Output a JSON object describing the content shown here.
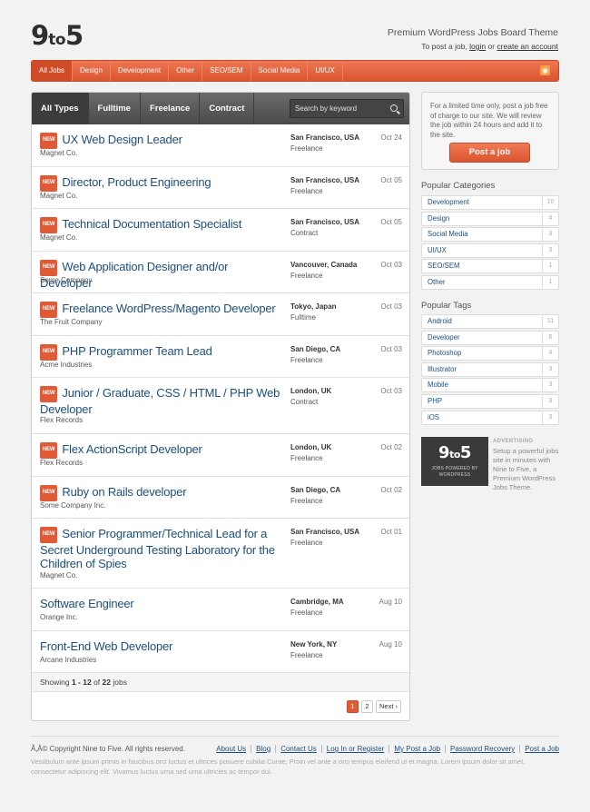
{
  "header": {
    "logo_big": "9",
    "logo_small": "to",
    "logo_big2": "5",
    "tagline": "Premium WordPress Jobs Board Theme",
    "post_prefix": "To post a job, ",
    "login": "login",
    "or": " or ",
    "create_account": "create an account"
  },
  "nav": {
    "items": [
      "All Jobs",
      "Design",
      "Development",
      "Other",
      "SEO/SEM",
      "Social Media",
      "UI/UX"
    ],
    "rss_icon": "rss-icon"
  },
  "tabs": [
    "All Types",
    "Fulltime",
    "Freelance",
    "Contract"
  ],
  "search": {
    "placeholder": "Search by keyword"
  },
  "badge": "NEW",
  "jobs": [
    {
      "title": "UX Web Design Leader",
      "company": "Magnet Co.",
      "location": "San Francisco, USA",
      "type": "Freelance",
      "date": "Oct 24",
      "new": true
    },
    {
      "title": "Director, Product Engineering",
      "company": "Magnet Co.",
      "location": "San Francisco, USA",
      "type": "Freelance",
      "date": "Oct 05",
      "new": true
    },
    {
      "title": "Technical Documentation Specialist",
      "company": "Magnet Co.",
      "location": "San Francisco, USA",
      "type": "Contract",
      "date": "Oct 05",
      "new": true
    },
    {
      "title": "Web Application Designer and/or Developer",
      "company": "Some Company",
      "location": "Vancouver, Canada",
      "type": "Freelance",
      "date": "Oct 03",
      "new": true
    },
    {
      "title": "Freelance WordPress/Magento Developer",
      "company": "The Fruit Company",
      "location": "Tokyo, Japan",
      "type": "Fulltime",
      "date": "Oct 03",
      "new": true
    },
    {
      "title": "PHP Programmer Team Lead",
      "company": "Acme Industries",
      "location": "San Diego, CA",
      "type": "Freelance",
      "date": "Oct 03",
      "new": true
    },
    {
      "title": "Junior / Graduate, CSS / HTML / PHP Web Developer",
      "company": "Flex Records",
      "location": "London, UK",
      "type": "Contract",
      "date": "Oct 03",
      "new": true
    },
    {
      "title": "Flex ActionScript Developer",
      "company": "Flex Records",
      "location": "London, UK",
      "type": "Freelance",
      "date": "Oct 02",
      "new": true
    },
    {
      "title": "Ruby on Rails developer",
      "company": "Some Company Inc.",
      "location": "San Diego, CA",
      "type": "Freelance",
      "date": "Oct 02",
      "new": true
    },
    {
      "title": "Senior Programmer/Technical Lead for a Secret Underground Testing Laboratory for the Children of Spies",
      "company": "Magnet Co.",
      "location": "San Francisco, USA",
      "type": "Freelance",
      "date": "Oct 01",
      "new": true
    },
    {
      "title": "Software Engineer",
      "company": "Orange Inc.",
      "location": "Cambridge, MA",
      "type": "Freelance",
      "date": "Aug 10",
      "new": false
    },
    {
      "title": "Front-End Web Developer",
      "company": "Arcane Industries",
      "location": "New York, NY",
      "type": "Freelance",
      "date": "Aug 10",
      "new": false
    }
  ],
  "showing": {
    "prefix": "Showing ",
    "range": "1 - 12",
    "of": " of ",
    "total": "22",
    "suffix": " jobs"
  },
  "pager": [
    "1",
    "2",
    "Next ›"
  ],
  "promo": {
    "text": "For a limited time only, post a job free of charge to our site. We will review the job within 24 hours and add it to the site.",
    "button": "Post a job"
  },
  "categories": {
    "heading": "Popular Categories",
    "items": [
      {
        "name": "Development",
        "count": "10"
      },
      {
        "name": "Design",
        "count": "4"
      },
      {
        "name": "Social Media",
        "count": "3"
      },
      {
        "name": "UI/UX",
        "count": "3"
      },
      {
        "name": "SEO/SEM",
        "count": "1"
      },
      {
        "name": "Other",
        "count": "1"
      }
    ]
  },
  "tags": {
    "heading": "Popular Tags",
    "items": [
      {
        "name": "Android",
        "count": "11"
      },
      {
        "name": "Developer",
        "count": "6"
      },
      {
        "name": "Photoshop",
        "count": "4"
      },
      {
        "name": "Illustrator",
        "count": "3"
      },
      {
        "name": "Mobile",
        "count": "3"
      },
      {
        "name": "PHP",
        "count": "3"
      },
      {
        "name": "iOS",
        "count": "3"
      }
    ]
  },
  "ad": {
    "logo_big": "9",
    "logo_small": "to",
    "logo_big2": "5",
    "sub": "JOBS POWERED BY WORDPRESS",
    "label": "ADVERTISING",
    "text": "Setup a powerful jobs site in minutes with Nine to Five, a Premium WordPress Jobs Theme."
  },
  "footer": {
    "copyright": "Ã‚Â© Copyright Nine to Five. All rights reserved.",
    "links": [
      "About Us",
      "Blog",
      "Contact Us",
      "Log In or Register",
      "My Post a Job",
      "Password Recovery",
      "Post a Job"
    ],
    "lorem": "Vestibulum ante ipsum primis in faucibus orci luctus et ultrices posuere cubilia Curae; Proin vel ante a orci tempus eleifend ut et magna. Lorem ipsum dolor sit amet, consectetur adipiscing elit. Vivamus luctus urna sed urna ultricies ac tempor dui."
  },
  "colors": {
    "accent": "#e05a36",
    "link": "#1d4f7c",
    "dark_tab": "#4a4a4a"
  }
}
